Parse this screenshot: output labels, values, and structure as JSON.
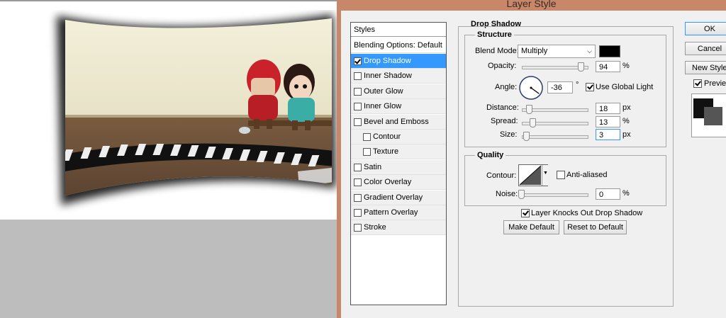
{
  "window": {
    "title": "Layer Style"
  },
  "styles_panel": {
    "header": "Styles",
    "blending_options": "Blending Options: Default",
    "items": [
      {
        "label": "Drop Shadow",
        "checked": true,
        "selected": true,
        "indent": false
      },
      {
        "label": "Inner Shadow",
        "checked": false,
        "selected": false,
        "indent": false
      },
      {
        "label": "Outer Glow",
        "checked": false,
        "selected": false,
        "indent": false
      },
      {
        "label": "Inner Glow",
        "checked": false,
        "selected": false,
        "indent": false
      },
      {
        "label": "Bevel and Emboss",
        "checked": false,
        "selected": false,
        "indent": false
      },
      {
        "label": "Contour",
        "checked": false,
        "selected": false,
        "indent": true
      },
      {
        "label": "Texture",
        "checked": false,
        "selected": false,
        "indent": true
      },
      {
        "label": "Satin",
        "checked": false,
        "selected": false,
        "indent": false
      },
      {
        "label": "Color Overlay",
        "checked": false,
        "selected": false,
        "indent": false
      },
      {
        "label": "Gradient Overlay",
        "checked": false,
        "selected": false,
        "indent": false
      },
      {
        "label": "Pattern Overlay",
        "checked": false,
        "selected": false,
        "indent": false
      },
      {
        "label": "Stroke",
        "checked": false,
        "selected": false,
        "indent": false
      }
    ]
  },
  "drop_shadow": {
    "section_title": "Drop Shadow",
    "structure_title": "Structure",
    "blend_mode": {
      "label": "Blend Mode:",
      "value": "Multiply",
      "color": "#000000"
    },
    "opacity": {
      "label": "Opacity:",
      "value": "94",
      "unit": "%",
      "level": 0.94
    },
    "angle": {
      "label": "Angle:",
      "value": "-36",
      "unit": "°",
      "degrees": -36
    },
    "use_global_light": {
      "label": "Use Global Light",
      "checked": true
    },
    "distance": {
      "label": "Distance:",
      "value": "18",
      "unit": "px",
      "level": 0.07
    },
    "spread": {
      "label": "Spread:",
      "value": "13",
      "unit": "%",
      "level": 0.13
    },
    "size": {
      "label": "Size:",
      "value": "3",
      "unit": "px",
      "level": 0.02
    }
  },
  "quality": {
    "title": "Quality",
    "contour_label": "Contour:",
    "anti_aliased": {
      "label": "Anti-aliased",
      "checked": false
    },
    "noise": {
      "label": "Noise:",
      "value": "0",
      "unit": "%",
      "level": 0
    },
    "knocks_out": {
      "label": "Layer Knocks Out Drop Shadow",
      "checked": true
    },
    "make_default": "Make Default",
    "reset_default": "Reset to Default"
  },
  "buttons": {
    "ok": "OK",
    "cancel": "Cancel",
    "new_style": "New Style...",
    "preview": {
      "label": "Preview",
      "checked": true
    }
  },
  "colors": {
    "selection": "#3399ff",
    "dialog_frame": "#c9876a",
    "dialog_bg": "#f0f0f0"
  }
}
